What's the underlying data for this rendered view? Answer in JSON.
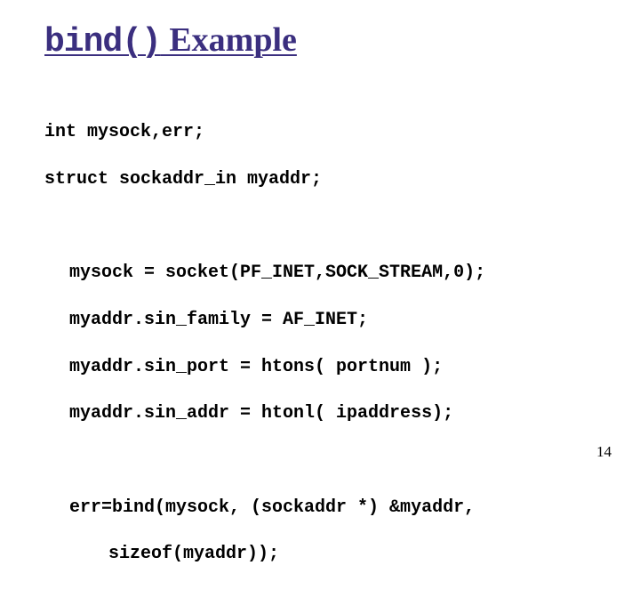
{
  "title": {
    "func": "bind()",
    "rest": " Example"
  },
  "code": {
    "decl1": "int mysock,err;",
    "decl2": "struct sockaddr_in myaddr;",
    "s1": "mysock = socket(PF_INET,SOCK_STREAM,0);",
    "s2": "myaddr.sin_family = AF_INET;",
    "s3": "myaddr.sin_port = htons( portnum );",
    "s4": "myaddr.sin_addr = htonl( ipaddress);",
    "b1": "err=bind(mysock, (sockaddr *) &myaddr,",
    "b2": "sizeof(myaddr));"
  },
  "page_number": "14"
}
